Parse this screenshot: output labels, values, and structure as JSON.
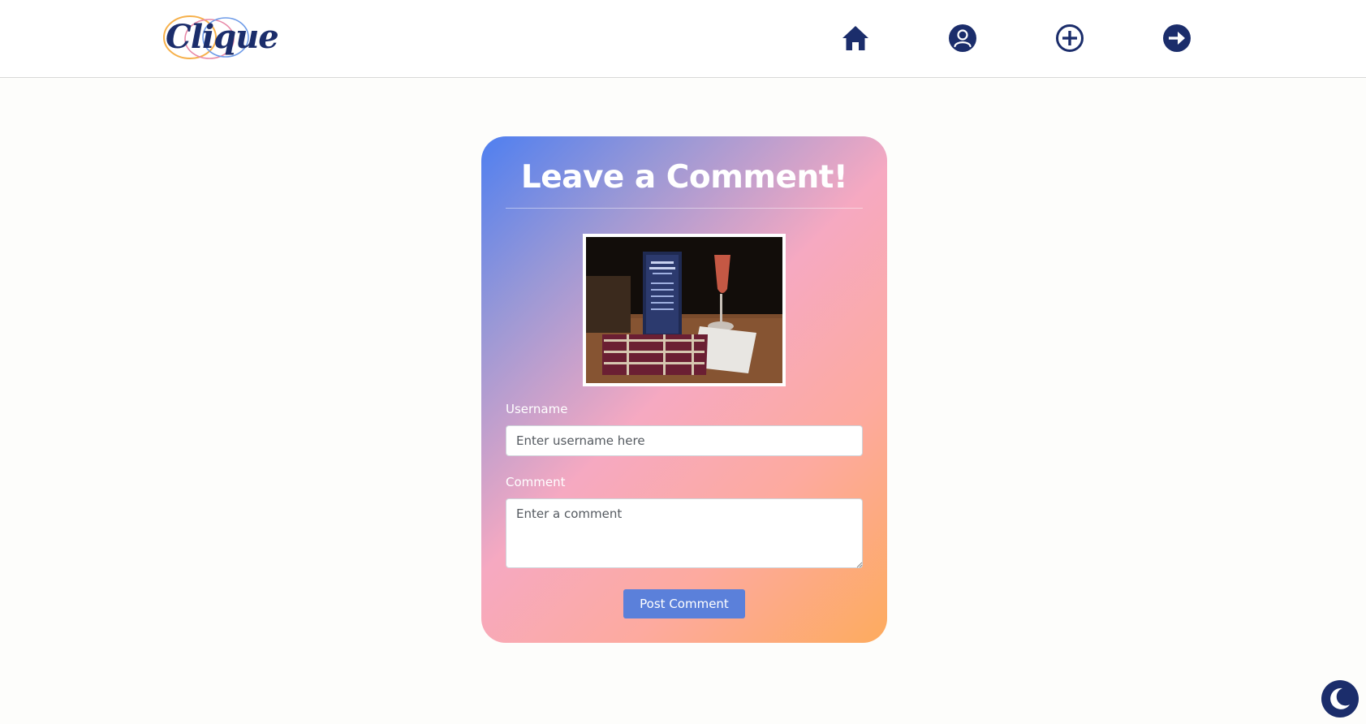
{
  "navbar": {
    "logo_text": "Clique",
    "icons": [
      {
        "name": "home-icon",
        "label": "home"
      },
      {
        "name": "profile-icon",
        "label": "profile"
      },
      {
        "name": "add-icon",
        "label": "add"
      },
      {
        "name": "logout-icon",
        "label": "logout"
      }
    ]
  },
  "card": {
    "title": "Leave a Comment!",
    "username_label": "Username",
    "username_placeholder": "Enter username here",
    "comment_label": "Comment",
    "comment_placeholder": "Enter a comment",
    "post_button_label": "Post Comment"
  },
  "colors": {
    "brand_navy": "#1b2d6b",
    "button_blue": "#5b80da",
    "gradient_start": "#4f7ff0",
    "gradient_mid": "#f6a9c1",
    "gradient_end": "#fdab5e"
  },
  "dark_mode_toggle": {
    "icon": "moon-icon"
  }
}
